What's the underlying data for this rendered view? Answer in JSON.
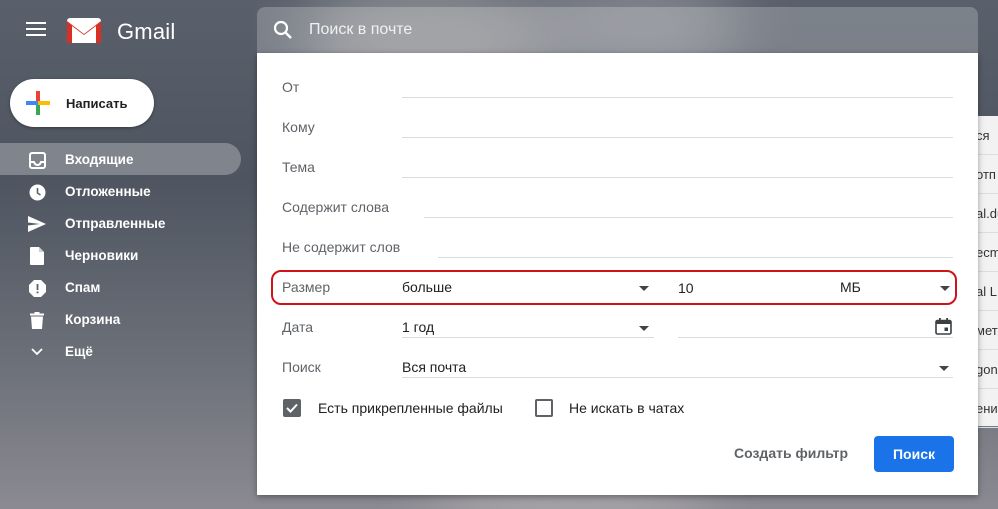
{
  "app": {
    "name": "Gmail"
  },
  "compose": {
    "label": "Написать"
  },
  "nav": {
    "items": [
      {
        "label": "Входящие",
        "icon": "inbox-icon",
        "active": true
      },
      {
        "label": "Отложенные",
        "icon": "clock-icon"
      },
      {
        "label": "Отправленные",
        "icon": "send-icon"
      },
      {
        "label": "Черновики",
        "icon": "draft-icon"
      },
      {
        "label": "Спам",
        "icon": "spam-icon"
      },
      {
        "label": "Корзина",
        "icon": "trash-icon"
      },
      {
        "label": "Ещё",
        "icon": "chevron-down-icon"
      }
    ]
  },
  "search": {
    "placeholder": "Поиск в почте"
  },
  "advanced": {
    "from_label": "От",
    "to_label": "Кому",
    "subject_label": "Тема",
    "has_words_label": "Содержит слова",
    "not_words_label": "Не содержит слов",
    "size_label": "Размер",
    "size_operator": "больше",
    "size_value": "10",
    "size_unit": "МБ",
    "date_label": "Дата",
    "date_within": "1 год",
    "search_in_label": "Поиск",
    "search_in_value": "Вся почта",
    "has_attachment_label": "Есть прикрепленные файлы",
    "has_attachment_checked": true,
    "exclude_chats_label": "Не искать в чатах",
    "exclude_chats_checked": false,
    "create_filter_label": "Создать фильтр",
    "search_button_label": "Поиск"
  },
  "peek": [
    "ся",
    "отп",
    "al.du",
    "ecmo",
    "al L",
    "мет",
    "gon",
    "ение"
  ],
  "colors": {
    "accent": "#1a73e8",
    "highlight": "#d0121a"
  }
}
